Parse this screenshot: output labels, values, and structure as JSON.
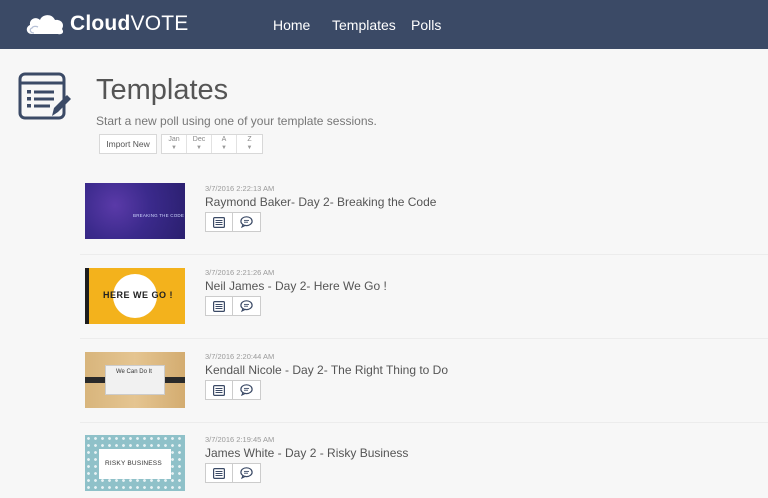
{
  "brand": {
    "name_bold": "Cloud",
    "name_light": "VOTE"
  },
  "nav": {
    "items": [
      "Home",
      "Templates",
      "Polls"
    ]
  },
  "page": {
    "title": "Templates",
    "subtitle": "Start a new poll using one of your template sessions."
  },
  "toolbar": {
    "import_label": "Import New",
    "sort": [
      {
        "label": "Jan",
        "caret": "▼"
      },
      {
        "label": "Dec",
        "caret": "▼"
      },
      {
        "label": "A",
        "caret": "▼"
      },
      {
        "label": "Z",
        "caret": "▼"
      }
    ]
  },
  "templates": [
    {
      "timestamp": "3/7/2016 2:22:13 AM",
      "title": "Raymond Baker- Day 2- Breaking the Code",
      "thumb_text": "BREAKING THE CODE",
      "thumb_sub": ""
    },
    {
      "timestamp": "3/7/2016 2:21:26 AM",
      "title": "Neil James - Day 2- Here We Go !",
      "thumb_text": "HERE WE GO !",
      "thumb_sub": ""
    },
    {
      "timestamp": "3/7/2016 2:20:44 AM",
      "title": "Kendall Nicole - Day 2- The Right Thing to Do",
      "thumb_text": "We Can Do It",
      "thumb_sub": ""
    },
    {
      "timestamp": "3/7/2016 2:19:45 AM",
      "title": "James White - Day 2 - Risky Business",
      "thumb_text": "RISKY BUSINESS",
      "thumb_sub": ""
    }
  ],
  "colors": {
    "header_bg": "#3b4a66",
    "accent": "#3b4a66",
    "page_bg": "#f7f7f7"
  },
  "icons": {
    "list_action": "list-icon",
    "poll_action": "speech-bubble-icon"
  }
}
